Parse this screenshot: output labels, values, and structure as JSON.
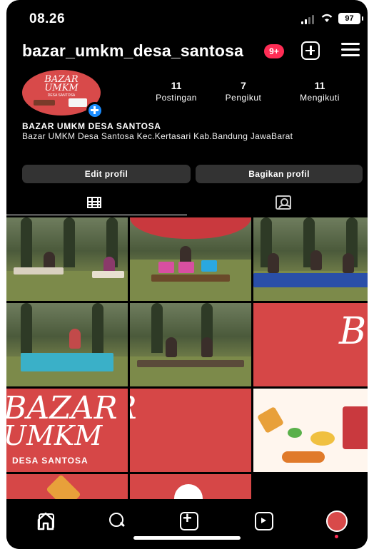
{
  "status_bar": {
    "time": "08.26",
    "battery": "97"
  },
  "header": {
    "username": "bazar_umkm_desa_santosa",
    "notification_badge": "9+"
  },
  "profile": {
    "avatar_text_line1": "BAZAR",
    "avatar_text_line2": "UMKM",
    "avatar_subtext": "DESA SANTOSA",
    "stats": [
      {
        "value": "11",
        "label": "Postingan"
      },
      {
        "value": "7",
        "label": "Pengikut"
      },
      {
        "value": "11",
        "label": "Mengikuti"
      }
    ],
    "display_name": "BAZAR UMKM DESA SANTOSA",
    "bio": "Bazar UMKM Desa Santosa Kec.Kertasari Kab.Bandung JawaBarat",
    "edit_profile_label": "Edit profil",
    "share_profile_label": "Bagikan profil"
  },
  "tabs": [
    {
      "icon": "grid-icon",
      "active": true
    },
    {
      "icon": "tagged-icon",
      "active": false
    }
  ],
  "posts": {
    "banner_line1": "BAZAR",
    "banner_line2": "UMKM",
    "banner_line3": "DESA SANTOSA",
    "banner_right": "B"
  },
  "bottom_nav": [
    {
      "icon": "home-icon"
    },
    {
      "icon": "search-icon"
    },
    {
      "icon": "create-icon"
    },
    {
      "icon": "reels-icon"
    },
    {
      "icon": "profile-avatar-icon"
    }
  ],
  "colors": {
    "background": "#000000",
    "brand_red": "#d64747",
    "badge_red": "#ff2d55",
    "button_gray": "#333333",
    "accent_blue": "#1a8cff"
  }
}
